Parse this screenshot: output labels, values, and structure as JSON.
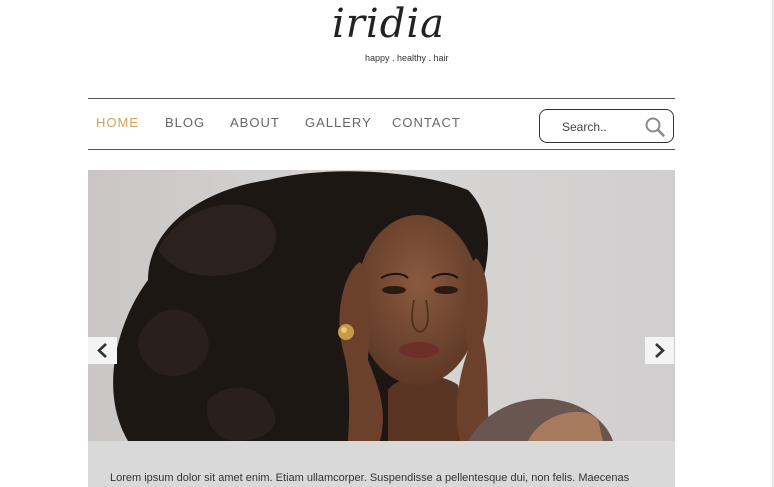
{
  "logo": {
    "wordmark": "iridia",
    "tagline": "happy . healthy . hair"
  },
  "nav": {
    "items": [
      {
        "label": "HOME",
        "active": true
      },
      {
        "label": "BLOG",
        "active": false
      },
      {
        "label": "ABOUT",
        "active": false
      },
      {
        "label": "GALLERY",
        "active": false
      },
      {
        "label": "CONTACT",
        "active": false
      }
    ]
  },
  "search": {
    "placeholder": "Search.."
  },
  "slider": {
    "prev_icon": "chevron-left-icon",
    "next_icon": "chevron-right-icon"
  },
  "caption": {
    "text": "Lorem ipsum dolor sit amet enim. Etiam ullamcorper. Suspendisse a pellentesque dui, non felis. Maecenas"
  },
  "colors": {
    "accent": "#d4a15a",
    "nav_text": "#666666",
    "caption_bg": "#d9d9d9",
    "slider_bg": "#cfcccb"
  }
}
